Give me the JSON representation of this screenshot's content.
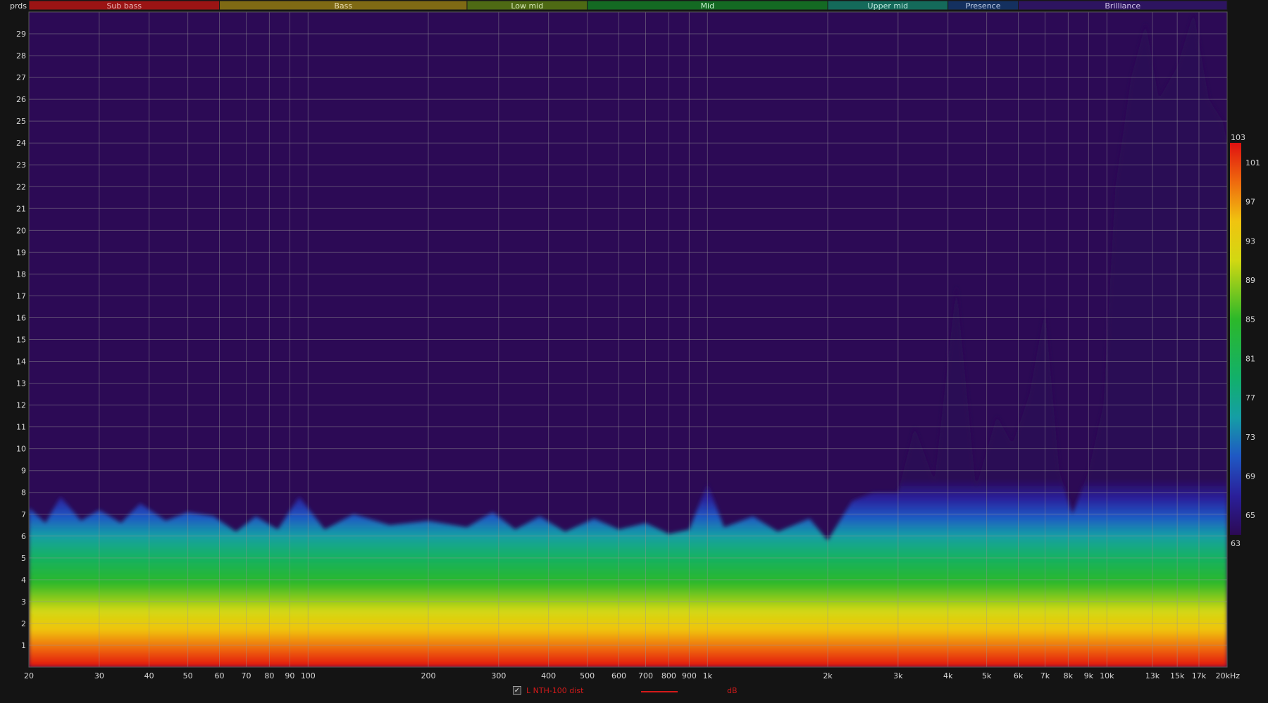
{
  "chart_data": {
    "type": "heatmap",
    "x_scale": "log",
    "x_range": [
      20,
      20000
    ],
    "y_range": [
      0,
      30
    ],
    "y_unit_label": "prds",
    "x_ticks": [
      {
        "v": 20,
        "label": "20"
      },
      {
        "v": 30,
        "label": "30"
      },
      {
        "v": 40,
        "label": "40"
      },
      {
        "v": 50,
        "label": "50"
      },
      {
        "v": 60,
        "label": "60"
      },
      {
        "v": 70,
        "label": "70"
      },
      {
        "v": 80,
        "label": "80"
      },
      {
        "v": 90,
        "label": "90"
      },
      {
        "v": 100,
        "label": "100"
      },
      {
        "v": 200,
        "label": "200"
      },
      {
        "v": 300,
        "label": "300"
      },
      {
        "v": 400,
        "label": "400"
      },
      {
        "v": 500,
        "label": "500"
      },
      {
        "v": 600,
        "label": "600"
      },
      {
        "v": 700,
        "label": "700"
      },
      {
        "v": 800,
        "label": "800"
      },
      {
        "v": 900,
        "label": "900"
      },
      {
        "v": 1000,
        "label": "1k"
      },
      {
        "v": 2000,
        "label": "2k"
      },
      {
        "v": 3000,
        "label": "3k"
      },
      {
        "v": 4000,
        "label": "4k"
      },
      {
        "v": 5000,
        "label": "5k"
      },
      {
        "v": 6000,
        "label": "6k"
      },
      {
        "v": 7000,
        "label": "7k"
      },
      {
        "v": 8000,
        "label": "8k"
      },
      {
        "v": 9000,
        "label": "9k"
      },
      {
        "v": 10000,
        "label": "10k"
      },
      {
        "v": 13000,
        "label": "13k"
      },
      {
        "v": 15000,
        "label": "15k"
      },
      {
        "v": 17000,
        "label": "17k"
      },
      {
        "v": 20000,
        "label": "20kHz"
      }
    ],
    "y_ticks": [
      1,
      2,
      3,
      4,
      5,
      6,
      7,
      8,
      9,
      10,
      11,
      12,
      13,
      14,
      15,
      16,
      17,
      18,
      19,
      20,
      21,
      22,
      23,
      24,
      25,
      26,
      27,
      28,
      29
    ],
    "bands": [
      {
        "name": "Sub bass",
        "from": 20,
        "to": 60,
        "color": "#9b1414",
        "text_color": "#e8b8b8"
      },
      {
        "name": "Bass",
        "from": 60,
        "to": 250,
        "color": "#7f6a14",
        "text_color": "#e8dcb0"
      },
      {
        "name": "Low mid",
        "from": 250,
        "to": 500,
        "color": "#4e6a14",
        "text_color": "#d8e8b8"
      },
      {
        "name": "Mid",
        "from": 500,
        "to": 2000,
        "color": "#146a23",
        "text_color": "#c0ecc8"
      },
      {
        "name": "Upper mid",
        "from": 2000,
        "to": 4000,
        "color": "#146a5a",
        "text_color": "#bfe8e0"
      },
      {
        "name": "Presence",
        "from": 4000,
        "to": 6000,
        "color": "#14305f",
        "text_color": "#c0cfe8"
      },
      {
        "name": "Brilliance",
        "from": 6000,
        "to": 20000,
        "color": "#2d1460",
        "text_color": "#d0c4e8"
      }
    ],
    "color_scale": {
      "min": 63,
      "max": 103,
      "ticks": [
        103,
        101,
        97,
        93,
        89,
        85,
        81,
        77,
        73,
        69,
        65,
        63
      ],
      "stops": [
        {
          "v": 63,
          "color": "#2c0a55"
        },
        {
          "v": 67,
          "color": "#2a1f9a"
        },
        {
          "v": 71,
          "color": "#1f58c4"
        },
        {
          "v": 75,
          "color": "#159ea5"
        },
        {
          "v": 79,
          "color": "#12b06a"
        },
        {
          "v": 85,
          "color": "#2cb82a"
        },
        {
          "v": 91,
          "color": "#d2d812"
        },
        {
          "v": 95,
          "color": "#f0c410"
        },
        {
          "v": 99,
          "color": "#ef6a0e"
        },
        {
          "v": 103,
          "color": "#e01010"
        }
      ]
    },
    "decay_profile": [
      {
        "f": 20,
        "periods": 7.3
      },
      {
        "f": 22,
        "periods": 6.6
      },
      {
        "f": 24,
        "periods": 7.8
      },
      {
        "f": 27,
        "periods": 6.7
      },
      {
        "f": 30,
        "periods": 7.2
      },
      {
        "f": 34,
        "periods": 6.6
      },
      {
        "f": 38,
        "periods": 7.5
      },
      {
        "f": 44,
        "periods": 6.7
      },
      {
        "f": 50,
        "periods": 7.1
      },
      {
        "f": 58,
        "periods": 6.9
      },
      {
        "f": 66,
        "periods": 6.2
      },
      {
        "f": 74,
        "periods": 6.9
      },
      {
        "f": 84,
        "periods": 6.3
      },
      {
        "f": 95,
        "periods": 7.8
      },
      {
        "f": 110,
        "periods": 6.3
      },
      {
        "f": 130,
        "periods": 7.0
      },
      {
        "f": 160,
        "periods": 6.5
      },
      {
        "f": 200,
        "periods": 6.7
      },
      {
        "f": 250,
        "periods": 6.4
      },
      {
        "f": 290,
        "periods": 7.1
      },
      {
        "f": 330,
        "periods": 6.3
      },
      {
        "f": 380,
        "periods": 6.9
      },
      {
        "f": 440,
        "periods": 6.2
      },
      {
        "f": 520,
        "periods": 6.8
      },
      {
        "f": 600,
        "periods": 6.3
      },
      {
        "f": 700,
        "periods": 6.6
      },
      {
        "f": 800,
        "periods": 6.1
      },
      {
        "f": 900,
        "periods": 6.3
      },
      {
        "f": 1000,
        "periods": 8.4
      },
      {
        "f": 1100,
        "periods": 6.4
      },
      {
        "f": 1300,
        "periods": 6.9
      },
      {
        "f": 1500,
        "periods": 6.2
      },
      {
        "f": 1800,
        "periods": 6.8
      },
      {
        "f": 2000,
        "periods": 5.8
      },
      {
        "f": 2300,
        "periods": 7.6
      },
      {
        "f": 2600,
        "periods": 8.0
      },
      {
        "f": 3000,
        "periods": 8.0
      },
      {
        "f": 3300,
        "periods": 11.0
      },
      {
        "f": 3700,
        "periods": 8.5
      },
      {
        "f": 4200,
        "periods": 17.5
      },
      {
        "f": 4700,
        "periods": 8.2
      },
      {
        "f": 5300,
        "periods": 11.5
      },
      {
        "f": 5800,
        "periods": 10.2
      },
      {
        "f": 6400,
        "periods": 12.5
      },
      {
        "f": 7000,
        "periods": 16.4
      },
      {
        "f": 7600,
        "periods": 9.0
      },
      {
        "f": 8200,
        "periods": 7.0
      },
      {
        "f": 9000,
        "periods": 9.0
      },
      {
        "f": 9800,
        "periods": 12.0
      },
      {
        "f": 10500,
        "periods": 22.0
      },
      {
        "f": 11500,
        "periods": 27.0
      },
      {
        "f": 12500,
        "periods": 29.5
      },
      {
        "f": 13500,
        "periods": 26.0
      },
      {
        "f": 15000,
        "periods": 27.5
      },
      {
        "f": 16500,
        "periods": 30.0
      },
      {
        "f": 18000,
        "periods": 26.0
      },
      {
        "f": 19500,
        "periods": 25.0
      },
      {
        "f": 20000,
        "periods": 24.0
      }
    ],
    "legend": [
      {
        "name": "L NTH-100 dist",
        "checked": true,
        "color": "#d41a1a",
        "unit": "dB"
      }
    ]
  },
  "legend": {
    "check_glyph": "✓",
    "name": "L NTH-100 dist",
    "unit": "dB"
  },
  "y_unit": "prds"
}
